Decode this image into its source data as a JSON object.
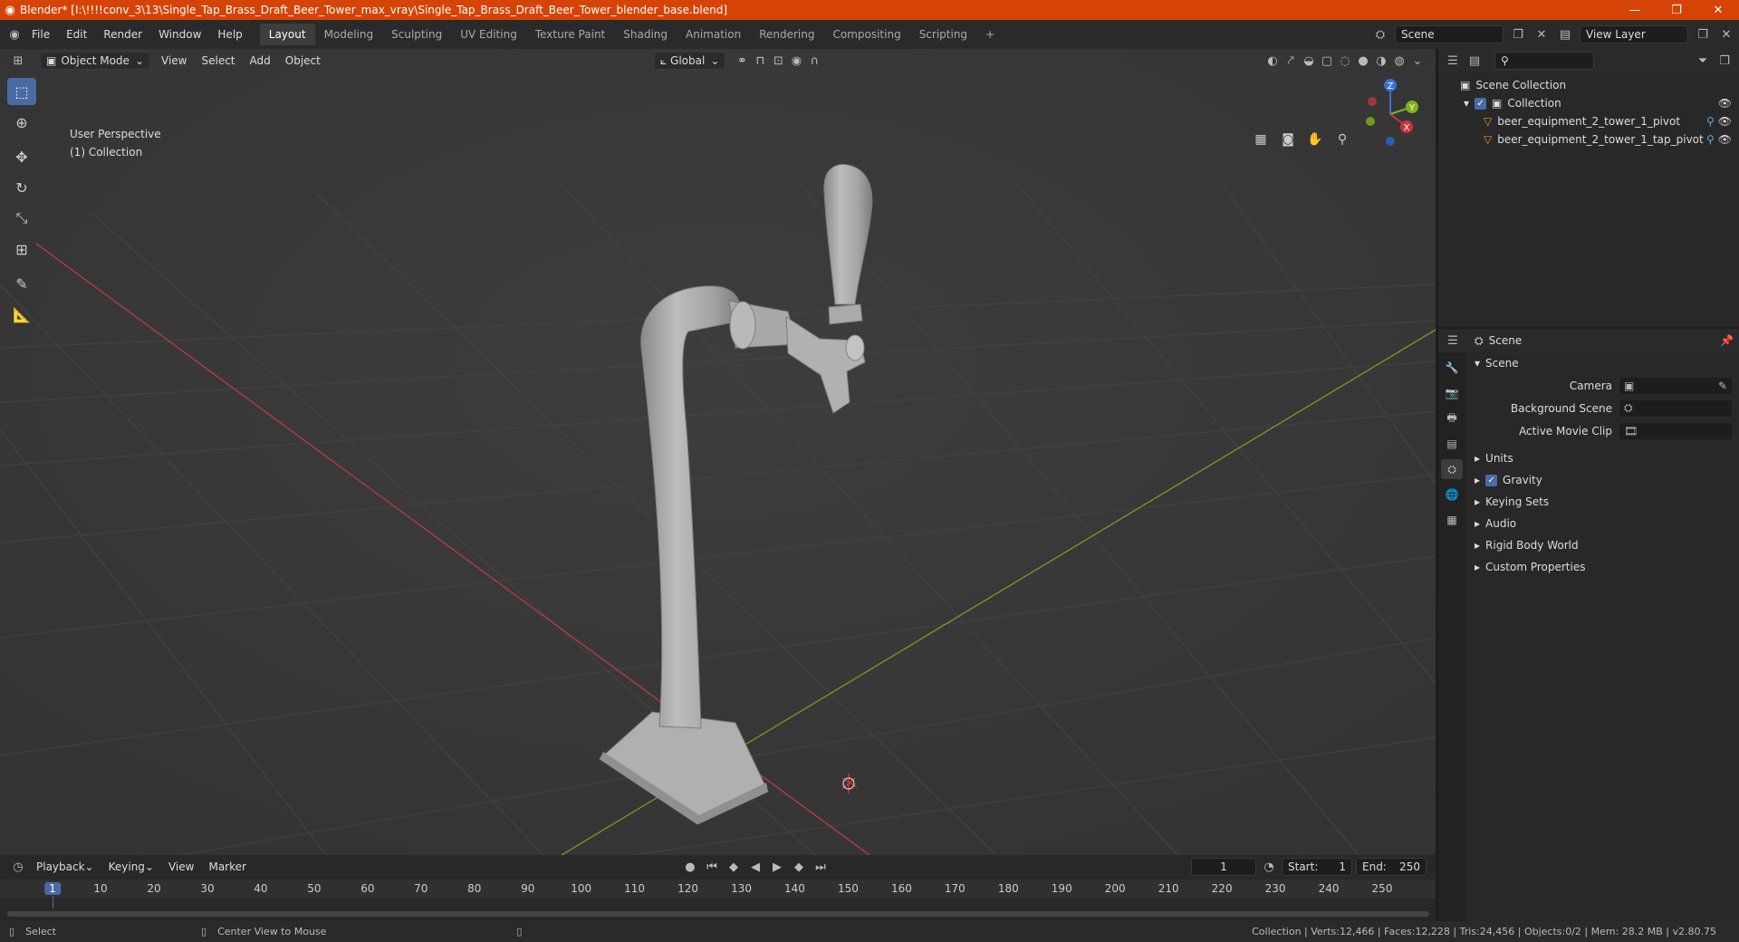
{
  "window": {
    "title": "Blender* [I:\\!!!!conv_3\\13\\Single_Tap_Brass_Draft_Beer_Tower_max_vray\\Single_Tap_Brass_Draft_Beer_Tower_blender_base.blend]"
  },
  "menu": [
    "File",
    "Edit",
    "Render",
    "Window",
    "Help"
  ],
  "workspaces": [
    "Layout",
    "Modeling",
    "Sculpting",
    "UV Editing",
    "Texture Paint",
    "Shading",
    "Animation",
    "Rendering",
    "Compositing",
    "Scripting"
  ],
  "topright": {
    "scene": "Scene",
    "view_layer": "View Layer"
  },
  "viewport_header": {
    "mode": "Object Mode",
    "menus": [
      "View",
      "Select",
      "Add",
      "Object"
    ],
    "orientation": "Global"
  },
  "viewport": {
    "perspective": "User Perspective",
    "collection": "(1) Collection"
  },
  "gizmo": {
    "x": "X",
    "y": "Y",
    "z": "Z"
  },
  "outliner": {
    "root": "Scene Collection",
    "collection": "Collection",
    "items": [
      "beer_equipment_2_tower_1_pivot",
      "beer_equipment_2_tower_1_tap_pivot"
    ]
  },
  "properties": {
    "header": "Scene",
    "panel": "Scene",
    "rows": [
      {
        "label": "Camera",
        "value": ""
      },
      {
        "label": "Background Scene",
        "value": ""
      },
      {
        "label": "Active Movie Clip",
        "value": ""
      }
    ],
    "sections": [
      "Units",
      "Gravity",
      "Keying Sets",
      "Audio",
      "Rigid Body World",
      "Custom Properties"
    ]
  },
  "timeline": {
    "menus": [
      "Playback",
      "Keying",
      "View",
      "Marker"
    ],
    "current_frame": "1",
    "start_label": "Start:",
    "start": "1",
    "end_label": "End:",
    "end": "250",
    "ruler": [
      "1",
      "10",
      "20",
      "30",
      "40",
      "50",
      "60",
      "70",
      "80",
      "90",
      "100",
      "110",
      "120",
      "130",
      "140",
      "150",
      "160",
      "170",
      "180",
      "190",
      "200",
      "210",
      "220",
      "230",
      "240",
      "250"
    ]
  },
  "statusbar": {
    "left": "Select",
    "middle": "Center View to Mouse",
    "right": "Collection | Verts:12,466 | Faces:12,228 | Tris:24,456 | Objects:0/2 | Mem: 28.2 MB | v2.80.75"
  },
  "colors": {
    "accent": "#4a6aa3",
    "titlebar": "#d64306",
    "x_axis": "#c8343c",
    "y_axis": "#7fb31c",
    "z_axis": "#3472d6"
  }
}
